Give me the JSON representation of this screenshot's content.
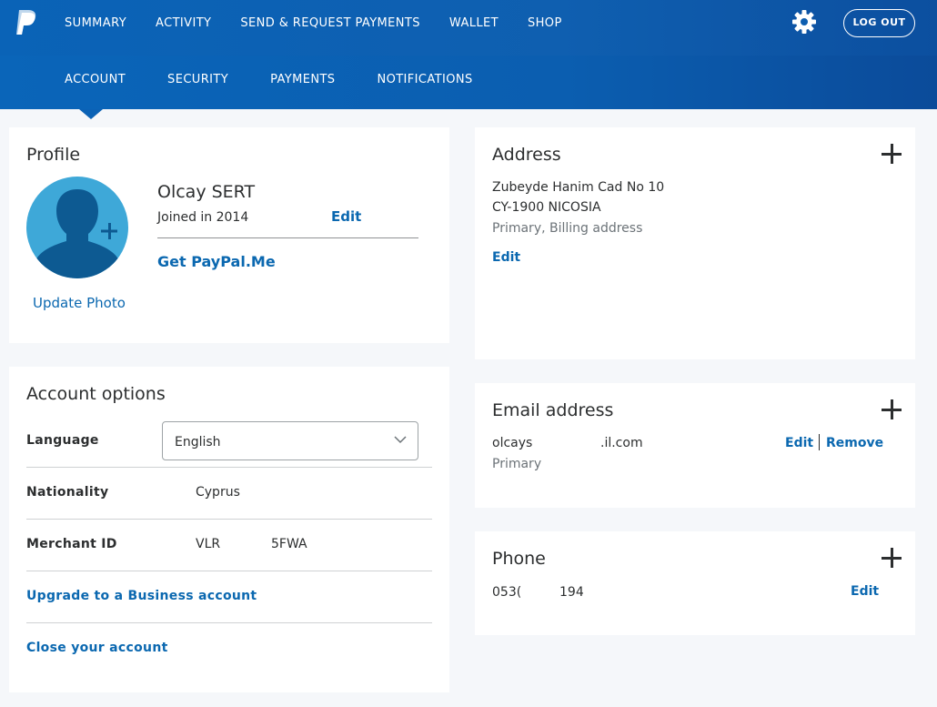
{
  "header": {
    "nav": [
      "SUMMARY",
      "ACTIVITY",
      "SEND & REQUEST PAYMENTS",
      "WALLET",
      "SHOP"
    ],
    "logout": "LOG OUT"
  },
  "subnav": [
    "ACCOUNT",
    "SECURITY",
    "PAYMENTS",
    "NOTIFICATIONS"
  ],
  "profile": {
    "title": "Profile",
    "name": "Olcay SERT",
    "joined": "Joined in 2014",
    "edit": "Edit",
    "paypalme": "Get PayPal.Me",
    "update_photo": "Update Photo"
  },
  "account_options": {
    "title": "Account options",
    "language_label": "Language",
    "language_value": "English",
    "nationality_label": "Nationality",
    "nationality_value": "Cyprus",
    "merchant_label": "Merchant ID",
    "merchant_value_a": "VLR",
    "merchant_value_b": "5FWA",
    "upgrade": "Upgrade to a Business account",
    "close": "Close your account"
  },
  "address": {
    "title": "Address",
    "line1": "Zubeyde Hanim Cad No 10",
    "line2": "CY-1900 NICOSIA",
    "type": "Primary, Billing address",
    "edit": "Edit"
  },
  "email": {
    "title": "Email address",
    "value_a": "olcays",
    "value_b": ".il.com",
    "type": "Primary",
    "edit": "Edit",
    "remove": "Remove"
  },
  "phone": {
    "title": "Phone",
    "value_a": "053(",
    "value_b": "194",
    "edit": "Edit"
  },
  "colors": {
    "brand": "#0b5fb2",
    "link": "#0b68b0",
    "avatar": "#3ea8d8"
  }
}
